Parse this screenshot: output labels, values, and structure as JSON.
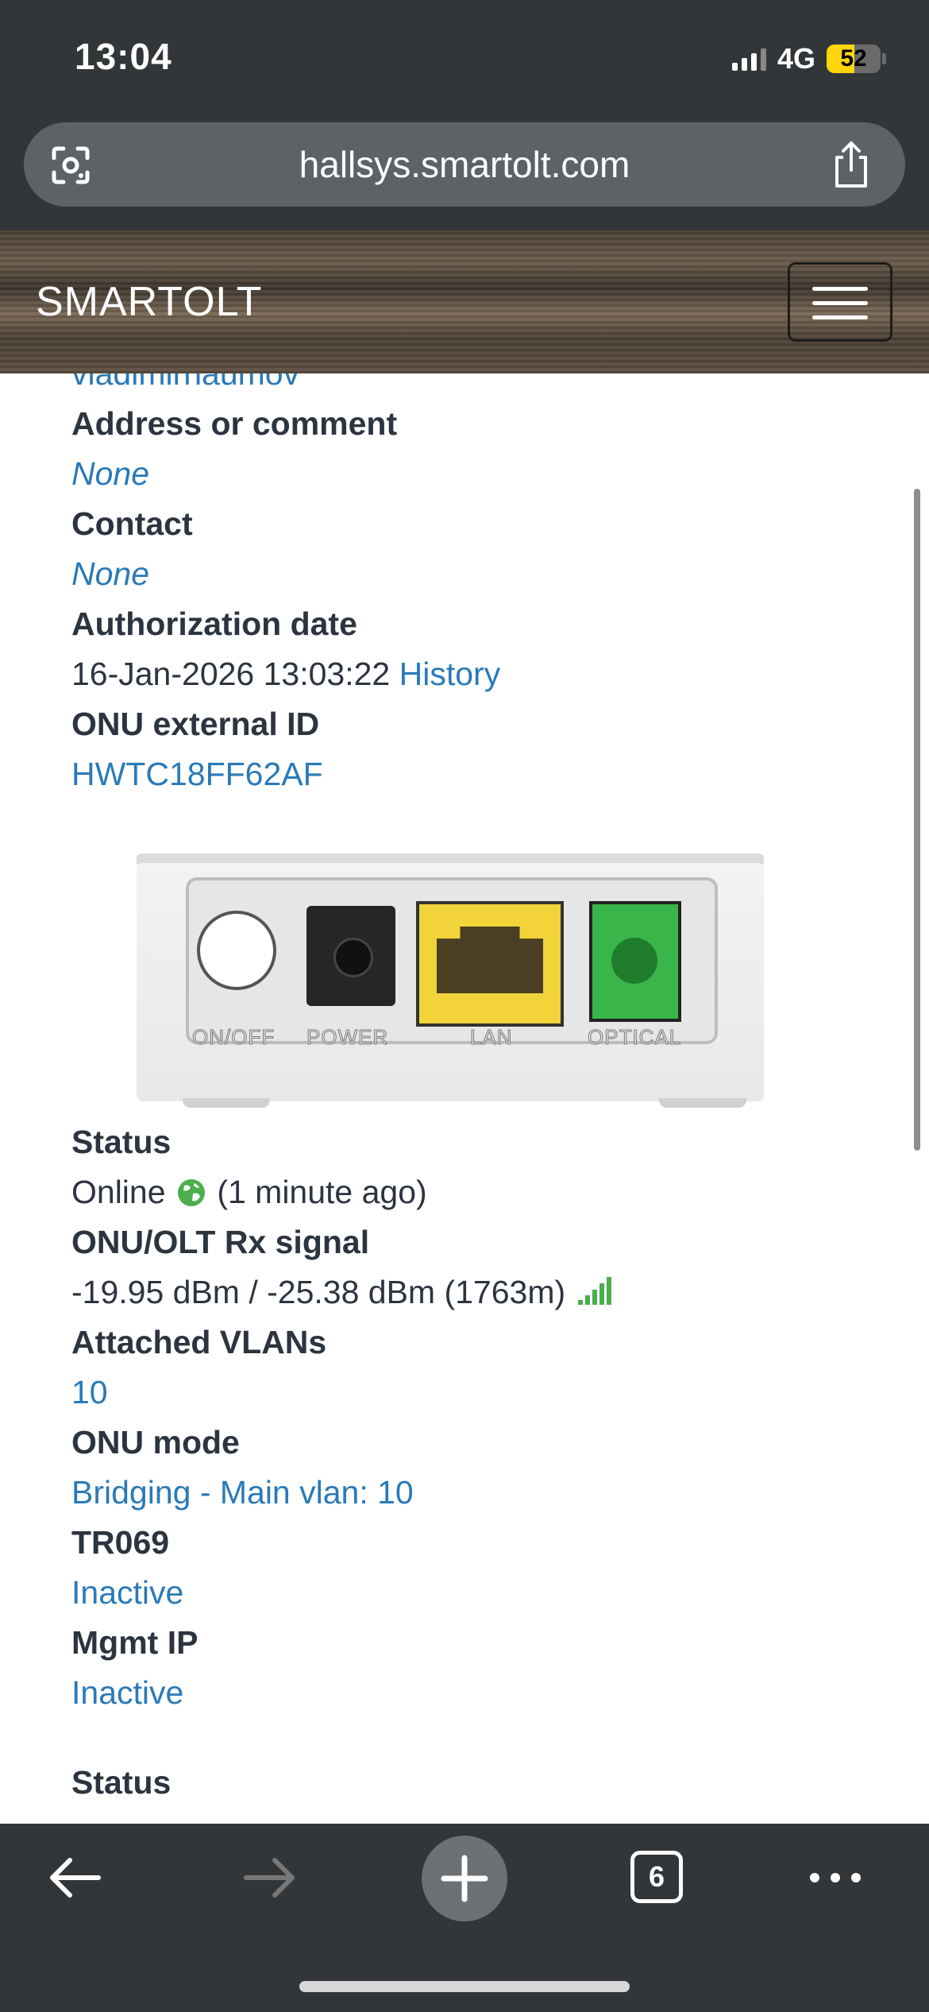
{
  "status_bar": {
    "time": "13:04",
    "network": "4G",
    "battery_level": "52"
  },
  "browser": {
    "url": "hallsys.smartolt.com",
    "open_tab_count": "6"
  },
  "site": {
    "logo": "SMARTOLT"
  },
  "details": {
    "username_partial": "vladimirnaumov",
    "address_label": "Address or comment",
    "address_value": "None",
    "contact_label": "Contact",
    "contact_value": "None",
    "auth_date_label": "Authorization date",
    "auth_date_value": "16-Jan-2026 13:03:22",
    "history_link": "History",
    "external_id_label": "ONU external ID",
    "external_id_value": "HWTC18FF62AF"
  },
  "device_ports": {
    "onoff": "ON/OFF",
    "power": "POWER",
    "lan": "LAN",
    "optical": "OPTICAL"
  },
  "onu_status": {
    "status_label": "Status",
    "status_value": "Online",
    "status_time": "(1 minute ago)",
    "signal_label": "ONU/OLT Rx signal",
    "signal_value": "-19.95 dBm / -25.38 dBm (1763m)",
    "signal_strength_bars": 5,
    "vlans_label": "Attached VLANs",
    "vlans_value": "10",
    "mode_label": "ONU mode",
    "mode_value": "Bridging - Main vlan: 10",
    "tr069_label": "TR069",
    "tr069_value": "Inactive",
    "mgmt_label": "Mgmt IP",
    "mgmt_value": "Inactive",
    "next_section_label": "Status"
  },
  "icons": {
    "globe": "globe-icon",
    "signal": "signal-bars-icon"
  },
  "colors": {
    "link": "#2a7ab8",
    "online": "#4cae4c",
    "chrome": "#323639"
  }
}
